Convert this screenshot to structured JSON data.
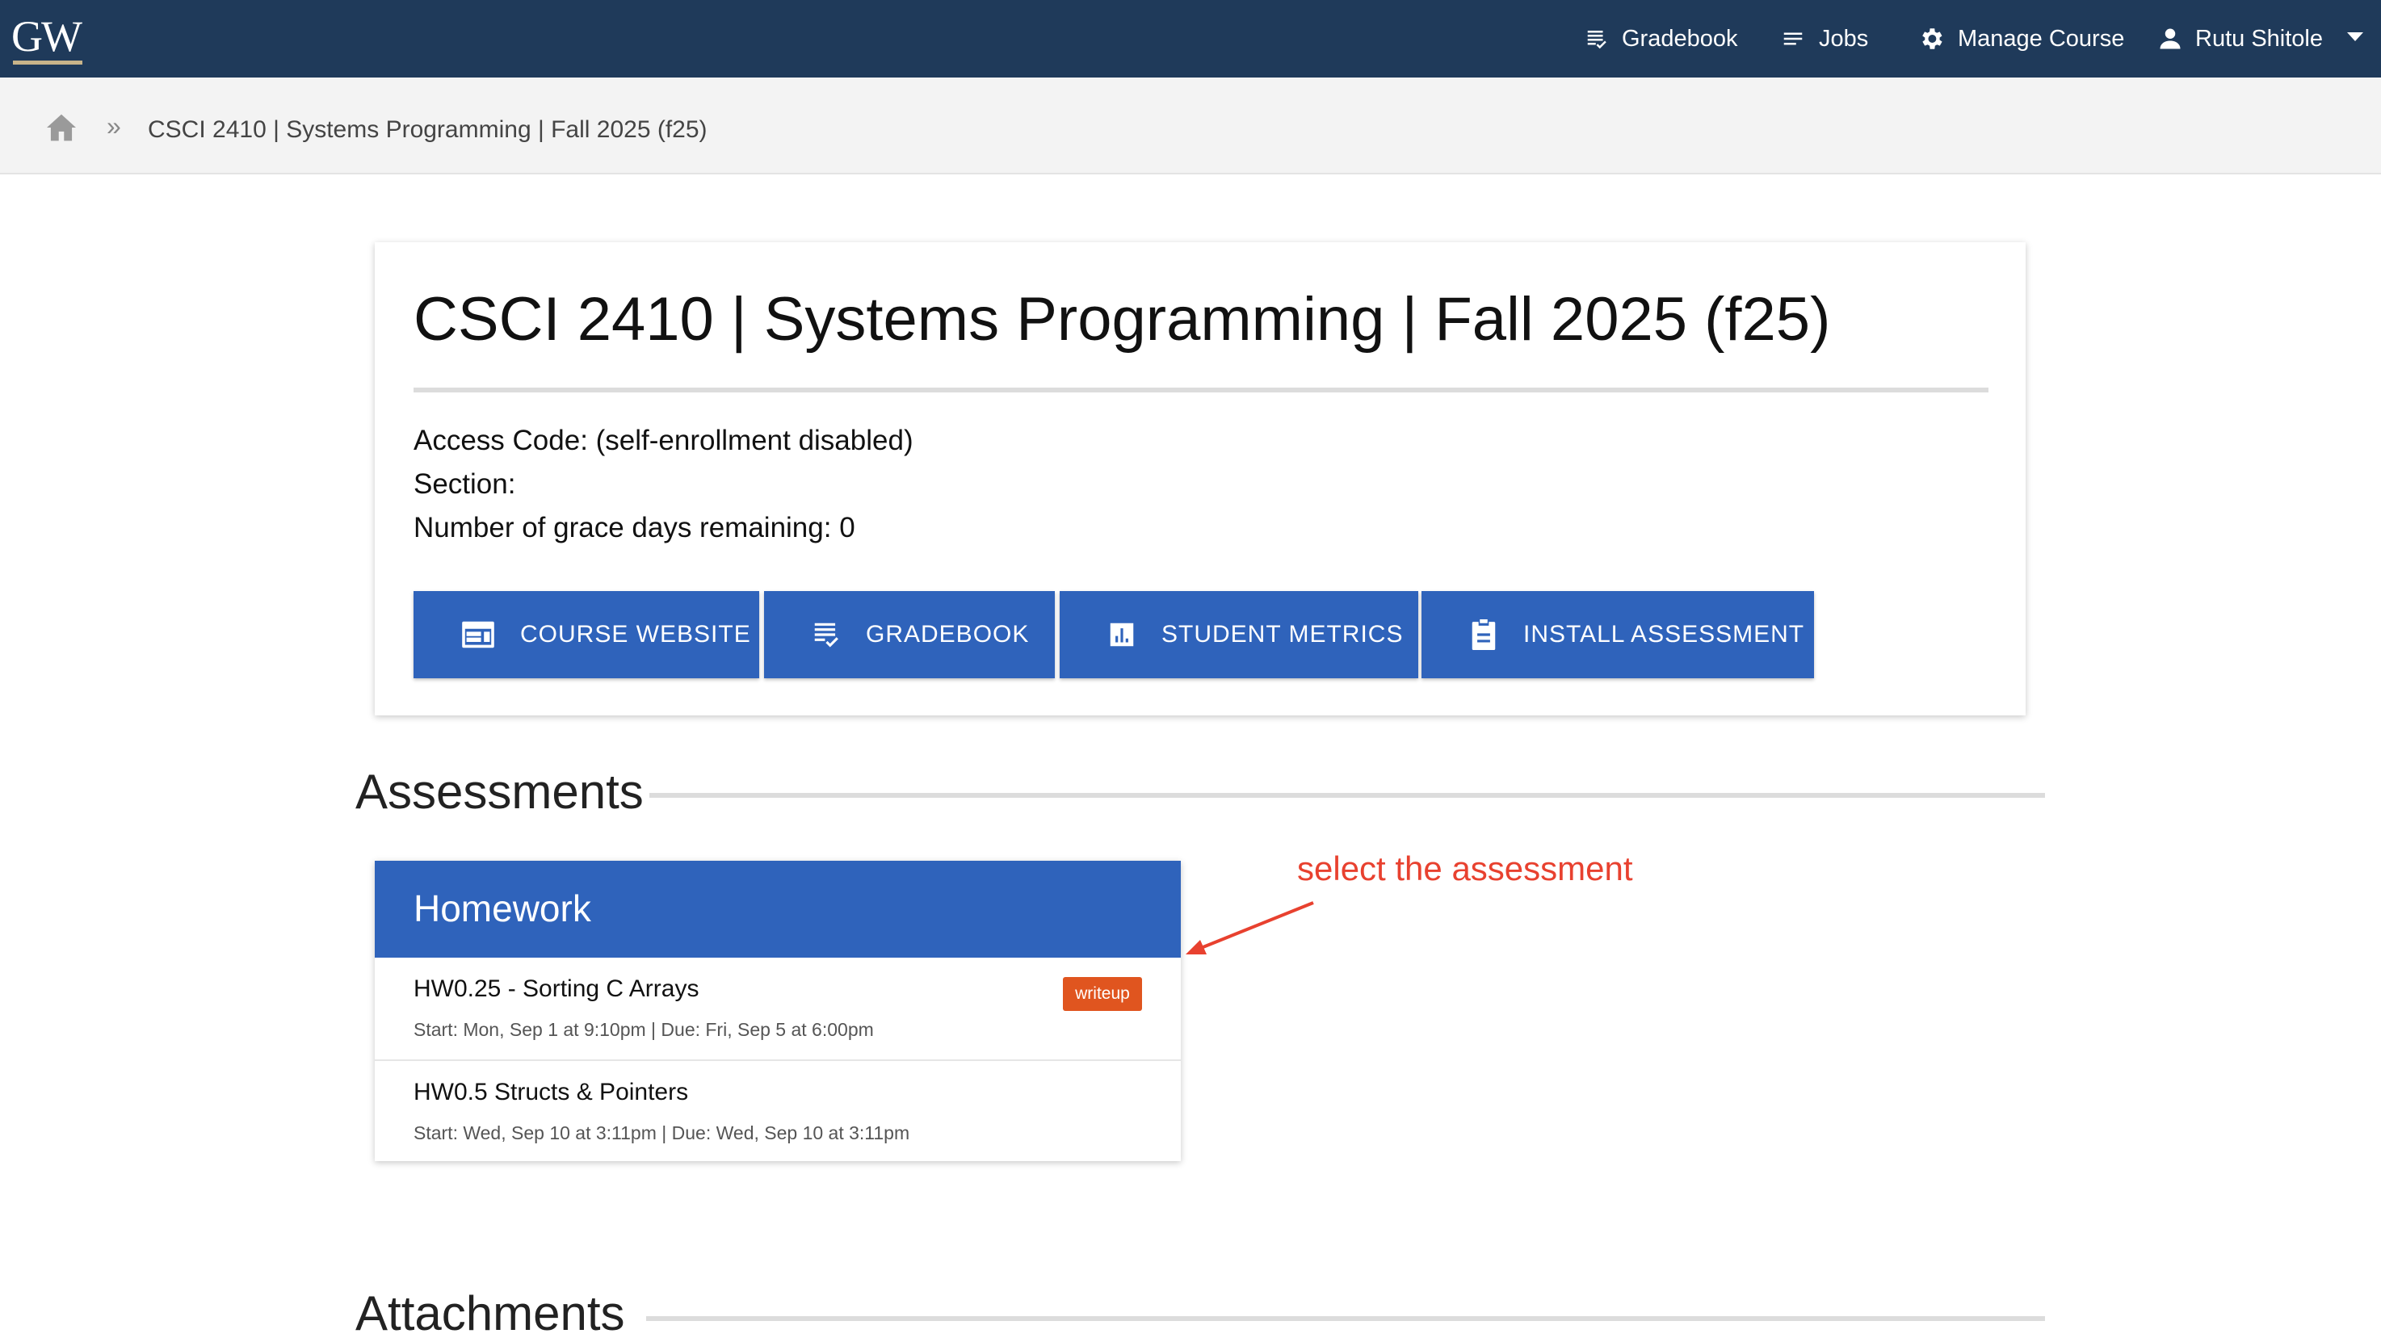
{
  "navbar": {
    "logo": "GW",
    "items": [
      {
        "label": "Gradebook",
        "icon": "gradebook-icon"
      },
      {
        "label": "Jobs",
        "icon": "jobs-icon"
      },
      {
        "label": "Manage Course",
        "icon": "gear-icon"
      },
      {
        "label": "Rutu Shitole",
        "icon": "user-icon"
      }
    ]
  },
  "breadcrumb": {
    "home_icon": "home-icon",
    "separator": "»",
    "current": "CSCI 2410 | Systems Programming | Fall 2025 (f25)"
  },
  "course": {
    "title": "CSCI 2410 | Systems Programming | Fall 2025 (f25)",
    "access_code": "Access Code: (self-enrollment disabled)",
    "section": "Section:",
    "grace_days": "Number of grace days remaining: 0",
    "buttons": [
      {
        "label": "COURSE WEBSITE",
        "icon": "web-icon"
      },
      {
        "label": "GRADEBOOK",
        "icon": "gradebook-icon"
      },
      {
        "label": "STUDENT METRICS",
        "icon": "chart-icon"
      },
      {
        "label": "INSTALL ASSESSMENT",
        "icon": "clipboard-icon"
      }
    ]
  },
  "assessments": {
    "heading": "Assessments",
    "category": "Homework",
    "items": [
      {
        "name": "HW0.25 - Sorting C Arrays",
        "badge": "writeup",
        "meta": "Start:  Mon, Sep 1 at 9:10pm  |   Due:  Fri, Sep 5 at 6:00pm"
      },
      {
        "name": "HW0.5 Structs & Pointers",
        "badge": "",
        "meta": "Start:  Wed, Sep 10 at 3:11pm  |   Due:  Wed, Sep 10 at 3:11pm"
      }
    ]
  },
  "attachments": {
    "heading": "Attachments"
  },
  "annotation": {
    "text": "select the assessment",
    "color": "#e8412f"
  },
  "colors": {
    "navbar": "#1f3a5a",
    "accent": "#2f63bb",
    "badge": "#e0551f"
  }
}
